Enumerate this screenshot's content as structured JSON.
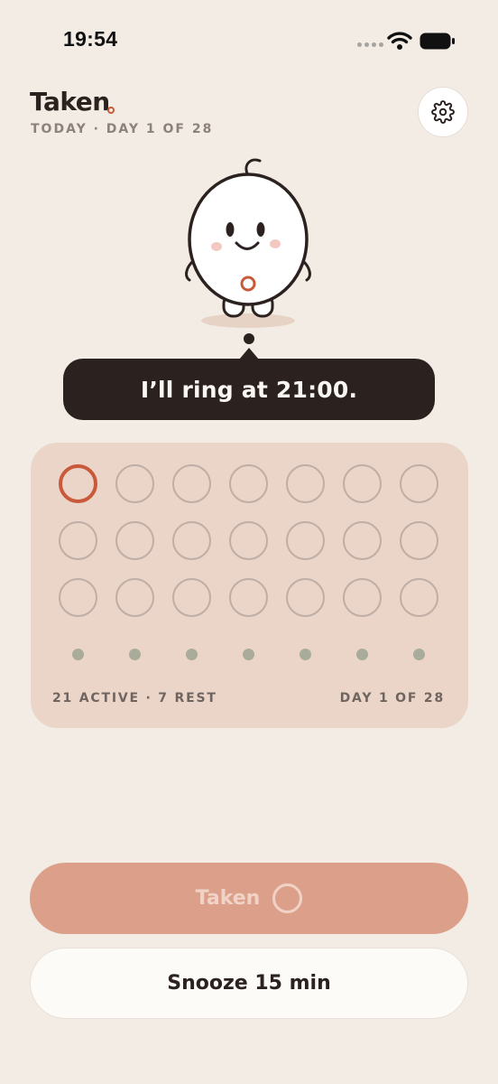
{
  "status_bar": {
    "time": "19:54",
    "icons": [
      "signal-dots-icon",
      "wifi-icon",
      "battery-icon"
    ]
  },
  "header": {
    "brand": "Taken",
    "subtitle": "TODAY · DAY 1 OF 28",
    "settings_icon": "gear-icon"
  },
  "mascot": {
    "icon": "egg-mascot-icon"
  },
  "bubble": {
    "text": "I’ll ring at 21:00."
  },
  "pack": {
    "active_count": 21,
    "rest_count": 7,
    "current_day": 1,
    "total_days": 28,
    "footer_left": "21 ACTIVE · 7 REST",
    "footer_right": "DAY 1 OF 28"
  },
  "actions": {
    "taken_label": "Taken",
    "snooze_label": "Snooze 15 min"
  },
  "colors": {
    "background": "#F3ECE4",
    "accent": "#C85A3B",
    "dark": "#2B2220",
    "pack_bg": "#EBD5C8",
    "taken_button": "#DCA08A",
    "rest_dot": "#A9AC9A"
  }
}
